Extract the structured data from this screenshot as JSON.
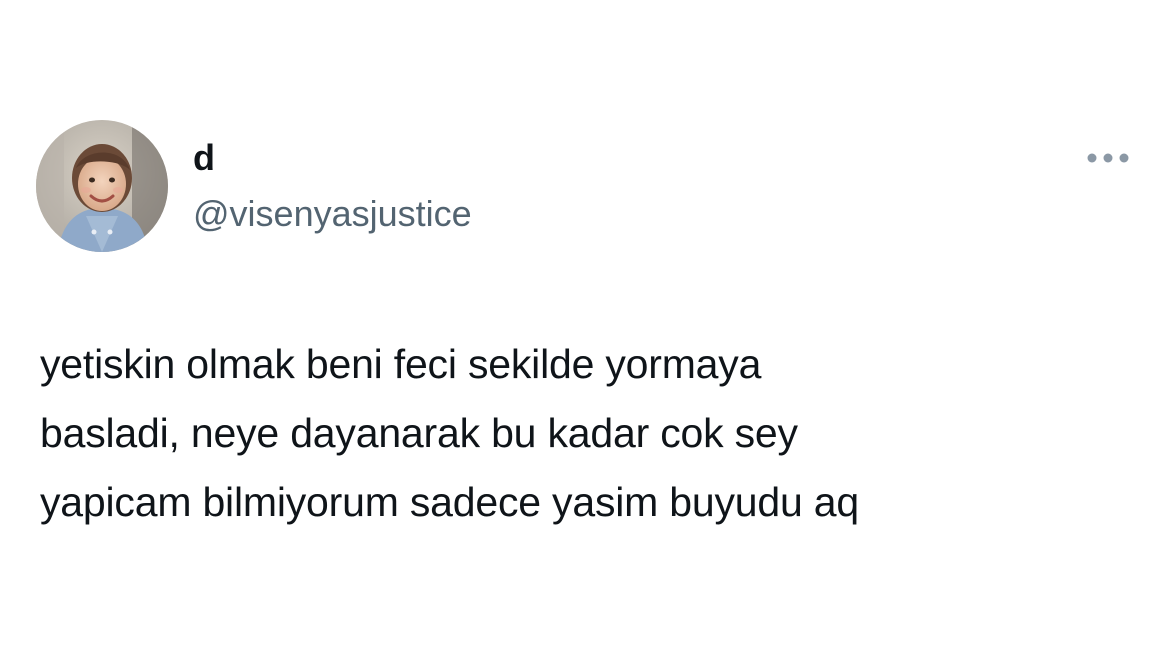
{
  "tweet": {
    "author": {
      "display_name": "d",
      "handle": "@visenyasjustice",
      "avatar_icon": "child-photo-avatar"
    },
    "more_icon": "more-horizontal-icon",
    "text_lines": [
      "yetiskin olmak beni feci sekilde yormaya",
      "basladi, neye dayanarak bu kadar cok sey",
      "yapicam bilmiyorum sadece yasim buyudu aq"
    ]
  },
  "colors": {
    "background": "#ffffff",
    "text_primary": "#0f1419",
    "text_secondary": "#536471",
    "icon_muted": "#8b98a5"
  }
}
